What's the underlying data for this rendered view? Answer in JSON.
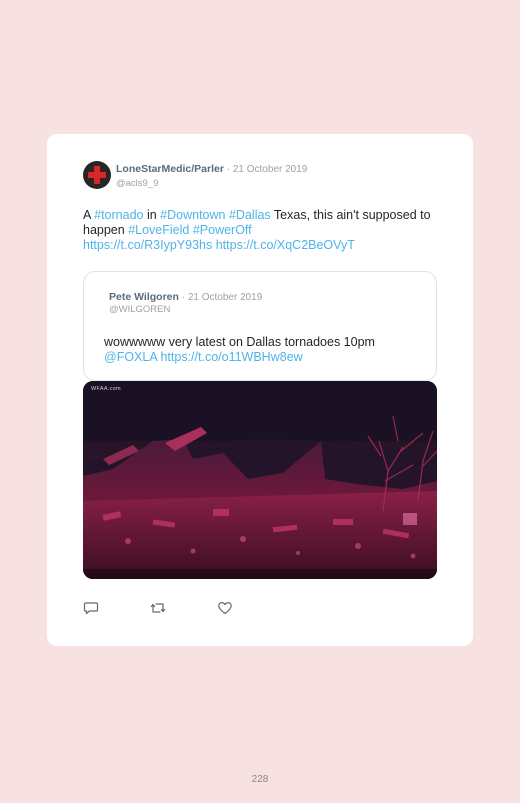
{
  "tweet": {
    "author_name": "LoneStarMedic/Parler",
    "separator": " · ",
    "date": "21 October 2019",
    "handle": "@acls9_9",
    "text_parts": {
      "p1": "A ",
      "p2": "#tornado",
      "p3": " in ",
      "p4": "#Downtown",
      "p5": " ",
      "p6": "#Dallas",
      "p7": " Texas, this ain't supposed to happen ",
      "p8": "#LoveField",
      "p9": " ",
      "p10": "#PowerOff",
      "p11": " ",
      "p12": "https://t.co/R3IypY93hs",
      "p13": " ",
      "p14": "https://t.co/XqC2BeOVyT"
    }
  },
  "quoted": {
    "author_name": "Pete Wilgoren",
    "separator": " · ",
    "date": "21 October 2019",
    "handle": "@WILGOREN",
    "text_parts": {
      "p1": "wowwwww very latest on Dallas tornadoes 10pm ",
      "p2": "@FOXLA",
      "p3": " ",
      "p4": "https://t.co/o11WBHw8ew"
    }
  },
  "media": {
    "watermark": "WFAA.com",
    "description_icon": "tornado-damage-photo"
  },
  "actions": {
    "reply_icon": "reply-icon",
    "retweet_icon": "retweet-icon",
    "like_icon": "heart-icon"
  },
  "page": {
    "number": "228"
  },
  "colors": {
    "background": "#f8e1e1",
    "link": "#4fb3e8",
    "name": "#5d6b78",
    "meta": "#9aa2aa"
  }
}
